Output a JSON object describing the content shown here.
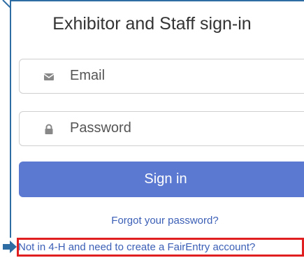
{
  "form": {
    "title": "Exhibitor and Staff sign-in",
    "email_placeholder": "Email",
    "password_placeholder": "Password",
    "signin_label": "Sign in",
    "forgot_label": "Forgot your password?",
    "create_account_label": "Not in 4-H and need to create a FairEntry account?"
  },
  "icons": {
    "email": "envelope-icon",
    "password": "lock-icon",
    "pointer": "arrow-right-icon"
  },
  "colors": {
    "primary_button": "#5b79d0",
    "link": "#3b5fb6",
    "highlight_box": "#e02020",
    "frame": "#2e6da4"
  }
}
